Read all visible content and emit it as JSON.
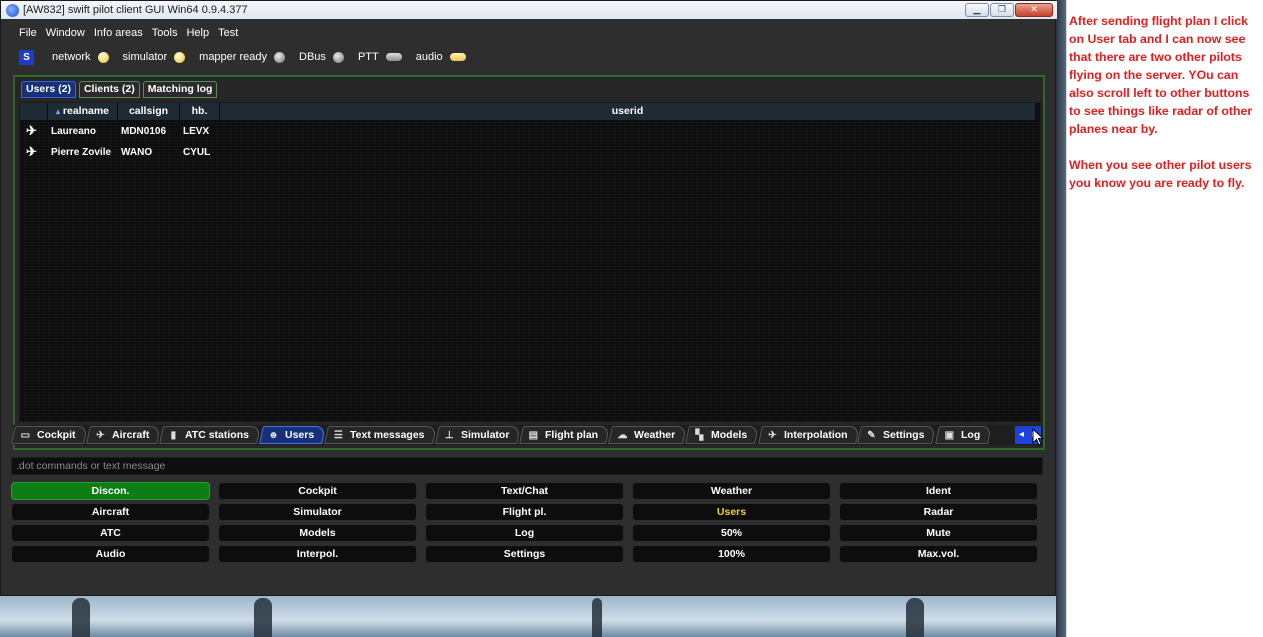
{
  "window": {
    "title": "[AW832] swift pilot client GUI Win64 0.9.4.377",
    "controls": {
      "minimize": "▁",
      "maximize": "❐",
      "close": "✕"
    }
  },
  "menu": [
    "File",
    "Window",
    "Info areas",
    "Tools",
    "Help",
    "Test"
  ],
  "status": {
    "logo": "S",
    "indicators": [
      {
        "label": "network",
        "state": "on",
        "shape": "led"
      },
      {
        "label": "simulator",
        "state": "on",
        "shape": "led"
      },
      {
        "label": "mapper ready",
        "state": "off",
        "shape": "led"
      },
      {
        "label": "DBus",
        "state": "off",
        "shape": "led"
      },
      {
        "label": "PTT",
        "state": "off",
        "shape": "pill"
      },
      {
        "label": "audio",
        "state": "on",
        "shape": "pill"
      }
    ]
  },
  "subtabs": [
    {
      "label": "Users (2)",
      "active": true
    },
    {
      "label": "Clients (2)",
      "active": false
    },
    {
      "label": "Matching log",
      "active": false
    }
  ],
  "table": {
    "columns": [
      "",
      "realname",
      "callsign",
      "hb.",
      "userid"
    ],
    "sort_indicator": "▴",
    "rows": [
      {
        "icon": "✈",
        "realname": "Laureano",
        "callsign": "MDN0106",
        "hb": "LEVX",
        "userid": ""
      },
      {
        "icon": "✈",
        "realname": "Pierre Zovile",
        "callsign": "WANO",
        "hb": "CYUL",
        "userid": ""
      }
    ]
  },
  "maintabs": [
    {
      "label": "Cockpit",
      "icon": "▭",
      "active": false
    },
    {
      "label": "Aircraft",
      "icon": "✈",
      "active": false
    },
    {
      "label": "ATC stations",
      "icon": "▮",
      "active": false
    },
    {
      "label": "Users",
      "icon": "☻",
      "active": true
    },
    {
      "label": "Text messages",
      "icon": "☰",
      "active": false
    },
    {
      "label": "Simulator",
      "icon": "⊥",
      "active": false
    },
    {
      "label": "Flight plan",
      "icon": "▤",
      "active": false
    },
    {
      "label": "Weather",
      "icon": "☁",
      "active": false
    },
    {
      "label": "Models",
      "icon": "▚",
      "active": false
    },
    {
      "label": "Interpolation",
      "icon": "✈",
      "active": false
    },
    {
      "label": "Settings",
      "icon": "✎",
      "active": false
    },
    {
      "label": "Log",
      "icon": "▣",
      "active": false
    }
  ],
  "scroll_buttons": [
    "◂",
    "▸"
  ],
  "command": {
    "placeholder": ".dot commands or text message"
  },
  "buttons": [
    {
      "label": "Discon.",
      "style": "green"
    },
    {
      "label": "Cockpit",
      "style": ""
    },
    {
      "label": "Text/Chat",
      "style": ""
    },
    {
      "label": "Weather",
      "style": ""
    },
    {
      "label": "Ident",
      "style": ""
    },
    {
      "label": "Aircraft",
      "style": ""
    },
    {
      "label": "Simulator",
      "style": ""
    },
    {
      "label": "Flight pl.",
      "style": ""
    },
    {
      "label": "Users",
      "style": "yellow"
    },
    {
      "label": "Radar",
      "style": ""
    },
    {
      "label": "ATC",
      "style": ""
    },
    {
      "label": "Models",
      "style": ""
    },
    {
      "label": "Log",
      "style": ""
    },
    {
      "label": "50%",
      "style": ""
    },
    {
      "label": "Mute",
      "style": ""
    },
    {
      "label": "Audio",
      "style": ""
    },
    {
      "label": "Interpol.",
      "style": ""
    },
    {
      "label": "Settings",
      "style": ""
    },
    {
      "label": "100%",
      "style": ""
    },
    {
      "label": "Max.vol.",
      "style": ""
    }
  ],
  "annotation": {
    "paragraph1": "After sending flight plan I click on User tab and I can now see that there are two other pilots flying on the server.  YOu can also scroll left to other buttons to see things like radar of other planes near by.",
    "paragraph2": "When you see other pilot users you know you are ready to fly."
  },
  "colors": {
    "accent_blue": "#1d3cc7",
    "connected_green": "#0f7d16",
    "active_yellow": "#f2cf32",
    "note_red": "#e02020"
  }
}
